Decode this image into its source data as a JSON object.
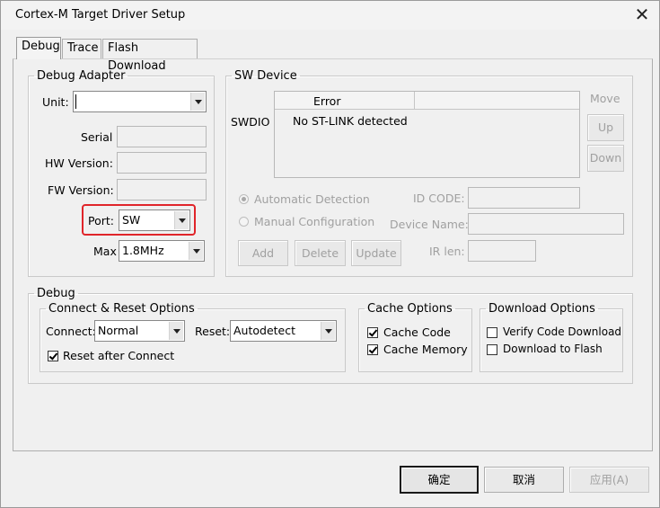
{
  "window": {
    "title": "Cortex-M Target Driver Setup",
    "close_glyph": "✕"
  },
  "tabs": [
    {
      "label": "Debug",
      "active": true
    },
    {
      "label": "Trace",
      "active": false
    },
    {
      "label": "Flash Download",
      "active": false
    }
  ],
  "debug_adapter": {
    "legend": "Debug Adapter",
    "unit_label": "Unit:",
    "unit_value": "",
    "serial_label": "Serial",
    "hw_version_label": "HW Version:",
    "fw_version_label": "FW Version:",
    "port_label": "Port:",
    "port_value": "SW",
    "max_label": "Max",
    "max_value": "1.8MHz"
  },
  "sw_device": {
    "legend": "SW Device",
    "swdio_label": "SWDIO",
    "column_header": "Error",
    "row_message": "No ST-LINK detected",
    "move_label": "Move",
    "up_button": "Up",
    "down_button": "Down",
    "automatic_detection": "Automatic Detection",
    "manual_configuration": "Manual Configuration",
    "id_code_label": "ID CODE:",
    "device_name_label": "Device Name:",
    "ir_len_label": "IR len:",
    "add_button": "Add",
    "delete_button": "Delete",
    "update_button": "Update"
  },
  "debug_group": {
    "legend": "Debug",
    "connect_reset": {
      "legend": "Connect & Reset Options",
      "connect_label": "Connect:",
      "connect_value": "Normal",
      "reset_label": "Reset:",
      "reset_value": "Autodetect",
      "reset_after_connect": "Reset after Connect",
      "reset_after_connect_checked": true
    },
    "cache_options": {
      "legend": "Cache Options",
      "cache_code": "Cache Code",
      "cache_code_checked": true,
      "cache_memory": "Cache Memory",
      "cache_memory_checked": true
    },
    "download_options": {
      "legend": "Download Options",
      "verify_code_download": "Verify Code Download",
      "verify_checked": false,
      "download_to_flash": "Download to Flash",
      "download_checked": false
    }
  },
  "footer": {
    "ok_button": "确定",
    "cancel_button": "取消",
    "apply_button": "应用(A)"
  },
  "colors": {
    "highlight_box": "#e0252a"
  }
}
